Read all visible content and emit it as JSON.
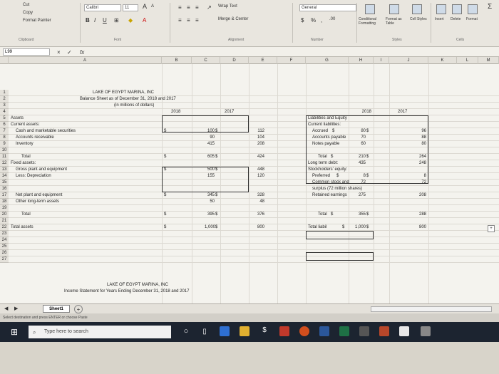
{
  "ribbon": {
    "cut": "Cut",
    "copy": "Copy",
    "format_painter": "Format Painter",
    "clipboard": "Clipboard",
    "font_name": "Calibri",
    "font_size": "11",
    "grow": "A",
    "shrink": "A",
    "bold": "B",
    "italic": "I",
    "underline": "U",
    "font_group": "Font",
    "wrap_text": "Wrap Text",
    "merge_center": "Merge & Center",
    "alignment_group": "Alignment",
    "number_format": "General",
    "currency": "$",
    "percent": "%",
    "comma": ",",
    "inc_dec": ".00",
    "number_group": "Number",
    "cond_format": "Conditional Formatting",
    "format_table": "Format as Table",
    "cell_styles": "Cell Styles",
    "styles_group": "Styles",
    "insert": "Insert",
    "delete": "Delete",
    "format": "Format",
    "cells_group": "Cells",
    "autosum": "Σ"
  },
  "formula_bar": {
    "name_box": "L99",
    "cancel": "×",
    "enter": "✓",
    "fx": "fx"
  },
  "columns": [
    "A",
    "B",
    "C",
    "D",
    "E",
    "F",
    "G",
    "H",
    "I",
    "J",
    "K",
    "L",
    "M"
  ],
  "rows": [
    "1",
    "2",
    "3",
    "4",
    "5",
    "6",
    "7",
    "8",
    "9",
    "10",
    "11",
    "12",
    "13",
    "14",
    "15",
    "16",
    "17",
    "18",
    "19",
    "20",
    "21",
    "22",
    "23",
    "24",
    "25",
    "26",
    "27"
  ],
  "sheet": {
    "title1": "LAKE OF EGYPT MARINA, INC",
    "title2": "Balance Sheet as of December 31, 2018 and 2017",
    "title3": "(in millions of dollars)",
    "y2018": "2018",
    "y2017": "2017",
    "assets": "Assets",
    "current_assets": "Current assets:",
    "cash": "Cash and marketable securities",
    "ar": "Accounts receivable",
    "inventory": "Inventory",
    "total": "Total",
    "fixed_assets": "Fixed assets:",
    "gross_plant": "Gross plant and equipment",
    "less_dep": "Less: Depreciation",
    "net_plant": "Net plant and equipment",
    "other_lt": "Other long-term assets",
    "total_assets": "Total assets",
    "dollar": "$",
    "cash18": "100",
    "cash17": "112",
    "ar18": "90",
    "ar17": "104",
    "inv18": "415",
    "inv17": "208",
    "tca18": "605",
    "tca17": "424",
    "gp18": "500",
    "gp17": "448",
    "dep18": "155",
    "dep17": "120",
    "np18": "345",
    "np17": "328",
    "olt18": "50",
    "olt17": "48",
    "tfa18": "395",
    "tfa17": "376",
    "ta18": "1,000",
    "ta17": "800",
    "liab_eq": "Liabilities and Equity",
    "current_liab": "Current liabilities:",
    "accrued": "Accrued",
    "ap": "Accounts payable",
    "np": "Notes payable",
    "ltd": "Long term debt:",
    "se": "Stockholders' equity:",
    "preferred": "Preferred",
    "common_a": "Common stock and",
    "common_b": "surplus (72 million shares)",
    "retained": "Retained earnings",
    "total_liab": "Total liabil",
    "acc18": "80",
    "acc17": "96",
    "ap18": "70",
    "ap17": "88",
    "np18b": "60",
    "np17b": "80",
    "tcl18": "210",
    "tcl17": "264",
    "ltd18": "435",
    "ltd17": "248",
    "pref18": "8",
    "pref17": "8",
    "cs18": "72",
    "cs17": "72",
    "re18": "275",
    "re17": "208",
    "tse18": "355",
    "tse17": "288",
    "tl18": "1,000",
    "tl17": "800",
    "is_title1": "LAKE OF EGYPT MARINA, INC",
    "is_title2": "Income Statement for Years Ending December 31, 2018 and 2017"
  },
  "tabs": {
    "sheet1": "Sheet1",
    "add": "+"
  },
  "status": "Select destination and press ENTER or choose Paste",
  "taskbar": {
    "search": "Type here to search"
  },
  "colors": {
    "taskbar": "#1c2430",
    "edge": "#2e6fd1",
    "excel": "#1e7145"
  }
}
